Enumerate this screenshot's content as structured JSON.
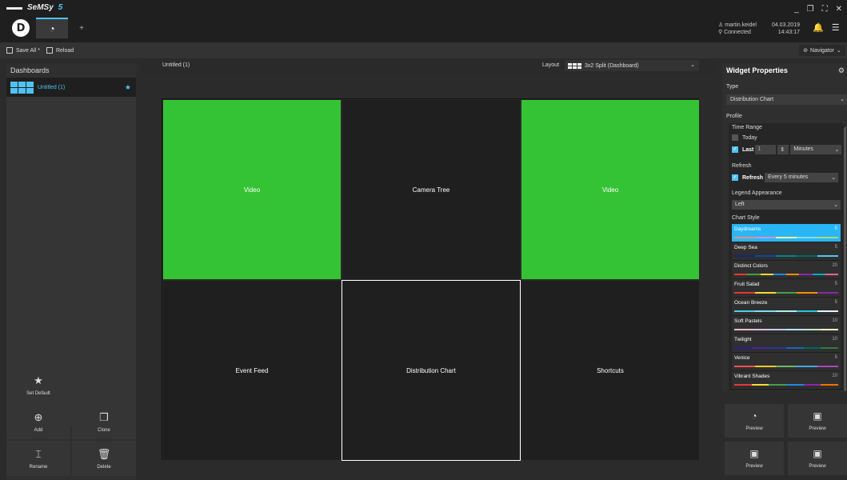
{
  "app": {
    "name": "SeMSy",
    "version": "5",
    "new_tab": "+"
  },
  "session": {
    "user": "martin.keidel",
    "status": "Connected",
    "date": "04.03.2019",
    "time": "14:43:17"
  },
  "toolbar": {
    "save_all": "Save All *",
    "reload": "Reload",
    "navigator": "Navigator"
  },
  "dashboards": {
    "title": "Dashboards",
    "items": [
      {
        "label": "Untitled (1)",
        "favorite": "★"
      }
    ],
    "buttons": {
      "set_default": "Set Default",
      "add": "Add",
      "clone": "Clone",
      "rename": "Rename",
      "delete": "Delete"
    }
  },
  "editor": {
    "title": "Untitled (1)",
    "layout_label": "Layout",
    "layout_value": "3x2 Split (Dashboard)",
    "cells": [
      {
        "label": "Video",
        "color": "#34c334"
      },
      {
        "label": "Camera Tree",
        "color": "#1f1f1f"
      },
      {
        "label": "Video",
        "color": "#34c334"
      },
      {
        "label": "Event Feed",
        "color": "#1f1f1f"
      },
      {
        "label": "Distribution Chart",
        "color": "#1f1f1f"
      },
      {
        "label": "Shortcuts",
        "color": "#1f1f1f"
      }
    ]
  },
  "widget": {
    "title": "Widget Properties",
    "type_label": "Type",
    "type_value": "Distribution Chart",
    "profile_label": "Profile",
    "time_range_label": "Time Range",
    "today": "Today",
    "last": "Last",
    "last_value": "1",
    "last_unit": "Minutes",
    "refresh_label": "Refresh",
    "refresh_cb": "Refresh",
    "refresh_value": "Every 5 minutes",
    "legend_label": "Legend Appearance",
    "legend_value": "Left",
    "chart_style_label": "Chart Style",
    "styles": [
      {
        "name": "Daydreams",
        "count": "5",
        "colors": [
          "#ff8a80",
          "#ce93d8",
          "#fff59d",
          "#80deea",
          "#aed581"
        ]
      },
      {
        "name": "Deep Sea",
        "count": "5",
        "colors": [
          "#1a237e",
          "#0d47a1",
          "#00838f",
          "#00695c",
          "#4fc3f7"
        ]
      },
      {
        "name": "Distinct Colors",
        "count": "20",
        "colors": [
          "#e53935",
          "#43a047",
          "#fdd835",
          "#1e88e5",
          "#fb8c00",
          "#8e24aa",
          "#00acc1",
          "#f06292"
        ]
      },
      {
        "name": "Fruit Salad",
        "count": "5",
        "colors": [
          "#e53935",
          "#fdd835",
          "#43a047",
          "#fb8c00",
          "#8e24aa"
        ]
      },
      {
        "name": "Ocean Breeze",
        "count": "5",
        "colors": [
          "#4dd0e1",
          "#80deea",
          "#b2ebf2",
          "#26c6da",
          "#e0f7fa"
        ]
      },
      {
        "name": "Soft Pastels",
        "count": "10",
        "colors": [
          "#f8bbd0",
          "#e1bee7",
          "#c5cae9",
          "#b3e5fc",
          "#c8e6c9",
          "#fff9c4"
        ]
      },
      {
        "name": "Twilight",
        "count": "10",
        "colors": [
          "#311b92",
          "#4527a0",
          "#283593",
          "#1565c0",
          "#00695c",
          "#2e7d32"
        ]
      },
      {
        "name": "Venice",
        "count": "5",
        "colors": [
          "#ef5350",
          "#ffca28",
          "#66bb6a",
          "#42a5f5",
          "#ab47bc"
        ]
      },
      {
        "name": "Vibrant Shades",
        "count": "10",
        "colors": [
          "#e53935",
          "#fdd835",
          "#43a047",
          "#1e88e5",
          "#8e24aa",
          "#ff6d00"
        ]
      }
    ],
    "preview_label": "Preview"
  }
}
